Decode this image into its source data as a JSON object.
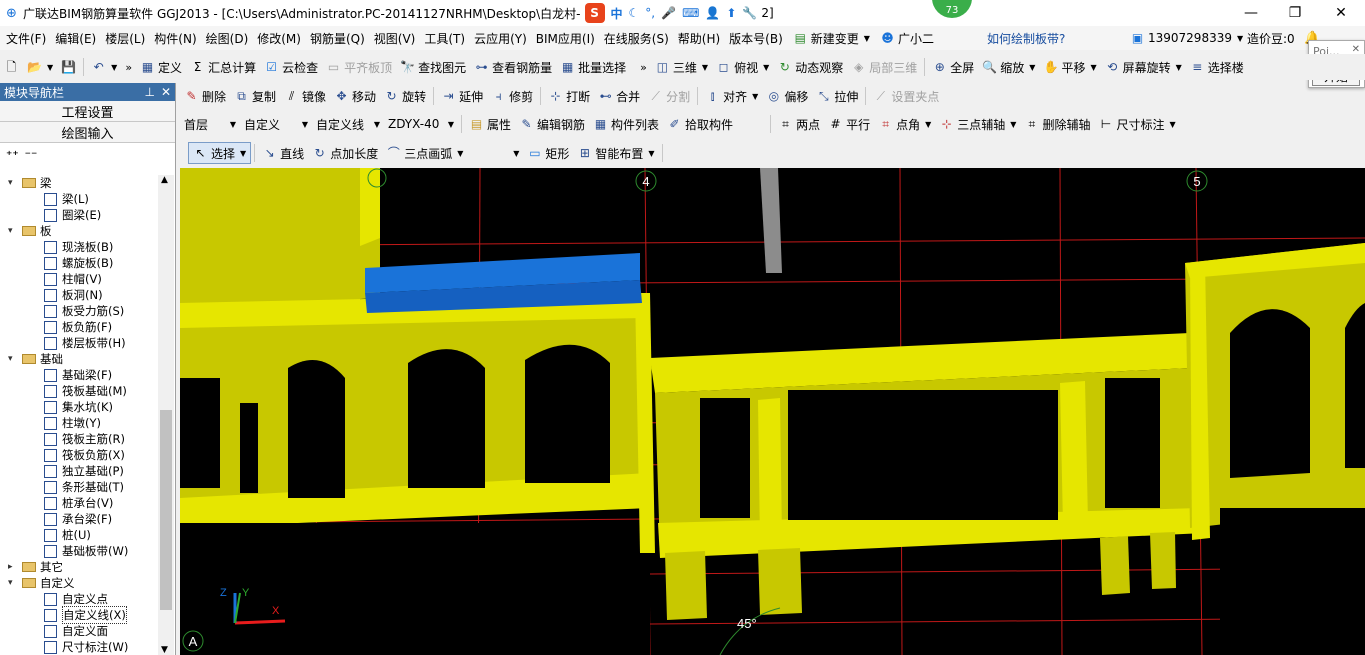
{
  "title": "广联达BIM钢筋算量软件 GGJ2013 - [C:\\Users\\Administrator.PC-20141127NRHM\\Desktop\\白龙村-",
  "title_tail": "2]",
  "ime": {
    "label": "中",
    "badge": "73"
  },
  "menu": [
    "文件(F)",
    "编辑(E)",
    "楼层(L)",
    "构件(N)",
    "绘图(D)",
    "修改(M)",
    "钢筋量(Q)",
    "视图(V)",
    "工具(T)",
    "云应用(Y)",
    "BIM应用(I)",
    "在线服务(S)",
    "帮助(H)",
    "版本号(B)"
  ],
  "menu_right": {
    "new_change": "新建变更",
    "assistant": "广小二",
    "help_link": "如何绘制板带?",
    "phone": "13907298339",
    "cost": "造价豆:0"
  },
  "popup": {
    "placeholder": "Poi...",
    "start": "开始"
  },
  "tb1": [
    "定义",
    "汇总计算",
    "云检查",
    "平齐板顶",
    "查找图元",
    "查看钢筋量",
    "批量选择",
    "三维",
    "俯视",
    "动态观察",
    "局部三维",
    "全屏",
    "缩放",
    "平移",
    "屏幕旋转",
    "选择楼"
  ],
  "tb2": [
    "删除",
    "复制",
    "镜像",
    "移动",
    "旋转",
    "延伸",
    "修剪",
    "打断",
    "合并",
    "分割",
    "对齐",
    "偏移",
    "拉伸",
    "设置夹点"
  ],
  "tb3": {
    "floor": "首层",
    "category": "自定义",
    "type": "自定义线",
    "component": "ZDYX-40",
    "items": [
      "属性",
      "编辑钢筋",
      "构件列表",
      "拾取构件",
      "两点",
      "平行",
      "点角",
      "三点辅轴",
      "删除辅轴",
      "尺寸标注"
    ]
  },
  "tb4": [
    "选择",
    "直线",
    "点加长度",
    "三点画弧",
    "矩形",
    "智能布置"
  ],
  "sidebar": {
    "title": "模块导航栏",
    "btn1": "工程设置",
    "btn2": "绘图输入",
    "tree": [
      {
        "level": 0,
        "label": "梁",
        "folder": true,
        "exp": "-"
      },
      {
        "level": 1,
        "label": "梁(L)"
      },
      {
        "level": 1,
        "label": "圈梁(E)"
      },
      {
        "level": 0,
        "label": "板",
        "folder": true,
        "exp": "-"
      },
      {
        "level": 1,
        "label": "现浇板(B)"
      },
      {
        "level": 1,
        "label": "螺旋板(B)"
      },
      {
        "level": 1,
        "label": "柱帽(V)"
      },
      {
        "level": 1,
        "label": "板洞(N)"
      },
      {
        "level": 1,
        "label": "板受力筋(S)"
      },
      {
        "level": 1,
        "label": "板负筋(F)"
      },
      {
        "level": 1,
        "label": "楼层板带(H)"
      },
      {
        "level": 0,
        "label": "基础",
        "folder": true,
        "exp": "-"
      },
      {
        "level": 1,
        "label": "基础梁(F)"
      },
      {
        "level": 1,
        "label": "筏板基础(M)"
      },
      {
        "level": 1,
        "label": "集水坑(K)"
      },
      {
        "level": 1,
        "label": "柱墩(Y)"
      },
      {
        "level": 1,
        "label": "筏板主筋(R)"
      },
      {
        "level": 1,
        "label": "筏板负筋(X)"
      },
      {
        "level": 1,
        "label": "独立基础(P)"
      },
      {
        "level": 1,
        "label": "条形基础(T)"
      },
      {
        "level": 1,
        "label": "桩承台(V)"
      },
      {
        "level": 1,
        "label": "承台梁(F)"
      },
      {
        "level": 1,
        "label": "桩(U)"
      },
      {
        "level": 1,
        "label": "基础板带(W)"
      },
      {
        "level": 0,
        "label": "其它",
        "folder": true,
        "exp": "+"
      },
      {
        "level": 0,
        "label": "自定义",
        "folder": true,
        "exp": "-"
      },
      {
        "level": 1,
        "label": "自定义点"
      },
      {
        "level": 1,
        "label": "自定义线(X)",
        "selected": true
      },
      {
        "level": 1,
        "label": "自定义面"
      },
      {
        "level": 1,
        "label": "尺寸标注(W)"
      }
    ]
  },
  "canvas": {
    "axis_labels": [
      "4",
      "5",
      "A"
    ],
    "angle": "45°",
    "axes": {
      "x": "X",
      "y": "Y",
      "z": "Z"
    }
  },
  "colors": {
    "yellow": "#e6e600",
    "blue": "#1a73d9",
    "grid": "#c01818",
    "accent": "#3a6ea5"
  }
}
